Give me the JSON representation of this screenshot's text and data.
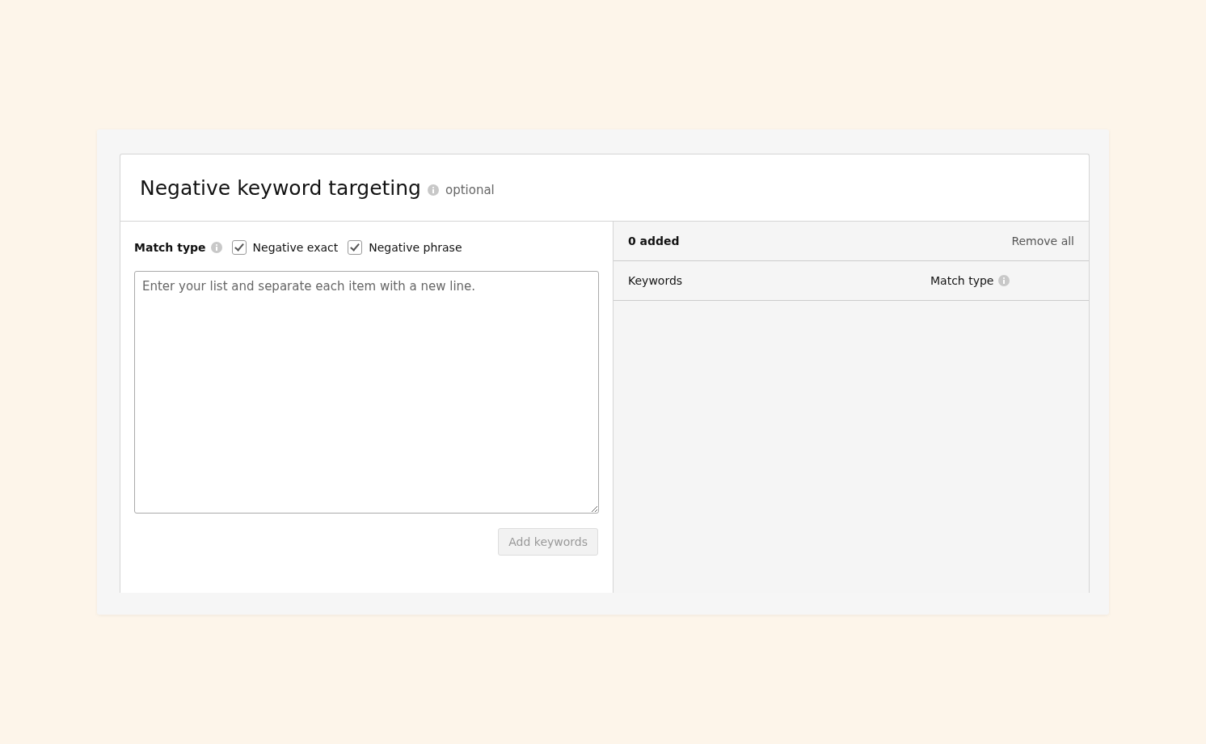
{
  "section": {
    "title": "Negative keyword targeting",
    "badge": "optional"
  },
  "match_type": {
    "label": "Match type",
    "options": [
      {
        "label": "Negative exact",
        "checked": true
      },
      {
        "label": "Negative phrase",
        "checked": true
      }
    ]
  },
  "keyword_input": {
    "placeholder": "Enter your list and separate each item with a new line."
  },
  "add_button": {
    "label": "Add keywords",
    "disabled": true
  },
  "added_list": {
    "count": "0 added",
    "remove_all": "Remove all",
    "columns": [
      "Keywords",
      "Match type"
    ]
  }
}
